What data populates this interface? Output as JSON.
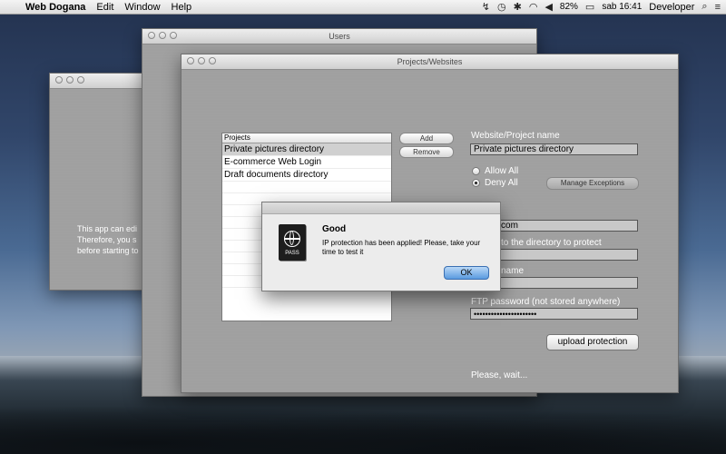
{
  "menubar": {
    "apple": "",
    "app_name": "Web Dogana",
    "menus": [
      "Edit",
      "Window",
      "Help"
    ],
    "battery": "82%",
    "clock": "sab 16:41",
    "user": "Developer"
  },
  "windows": {
    "left": {
      "title": "",
      "text": "This app can edi\nTherefore, you s\nbefore starting to"
    },
    "users": {
      "title": "Users"
    },
    "projects": {
      "title": "Projects/Websites",
      "list_header": "Projects",
      "list_items": [
        "Private pictures directory",
        "E-commerce Web Login",
        "Draft documents directory"
      ],
      "add_label": "Add",
      "remove_label": "Remove",
      "website_label": "Website/Project name",
      "website_value": "Private pictures directory",
      "allow_all": "Allow All",
      "deny_all": "Deny All",
      "manage_exceptions": "Manage Exceptions",
      "host_value": "ensen.com",
      "path_label": "to the directory to protect",
      "path_value": "v",
      "user_label": "name",
      "user_value": "",
      "ftp_label": "FTP password (not stored anywhere)",
      "ftp_value": "••••••••••••••••••••••",
      "upload_label": "upload protection",
      "wait_text": "Please, wait..."
    }
  },
  "dialog": {
    "icon_text": "PASS",
    "title": "Good",
    "message": "IP protection has been applied! Please, take your time to test it",
    "ok": "OK"
  }
}
